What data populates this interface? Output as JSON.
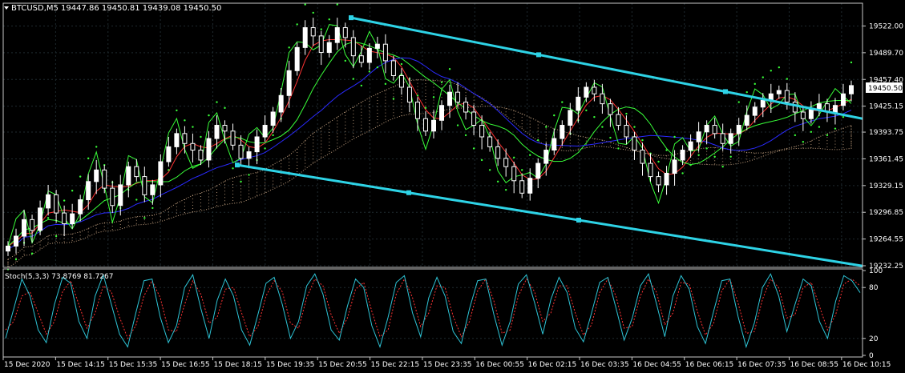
{
  "window": {
    "symbol_title": "BTCUSD,M5",
    "ohlc_text": "19447.86 19450.81 19439.08 19450.50",
    "current_price_label": "19450.50"
  },
  "colors": {
    "background": "#000000",
    "grid": "#1f2a2f",
    "axis": "#c8c8c8",
    "bull_candle": "#ffffff",
    "bear_candle": "#ffffff",
    "channel": "#2ed3e6",
    "cloud": "#f4c9a0",
    "ma_fast": "#ff3333",
    "ma_slow": "#2a2aff",
    "ma_green": "#39ff39",
    "psar": "#39ff39",
    "stoch_main": "#2ec4d6",
    "stoch_signal": "#ff3333"
  },
  "chart_data": [
    {
      "type": "candlestick",
      "title": "BTCUSD,M5",
      "price_ticks": [
        "19522.00",
        "19489.70",
        "19457.40",
        "19425.15",
        "19393.75",
        "19361.45",
        "19329.15",
        "19296.85",
        "19264.55",
        "19232.25"
      ],
      "ylim": [
        19232.25,
        19536.0
      ],
      "time_ticks": [
        "15 Dec 2020",
        "15 Dec 14:15",
        "15 Dec 15:35",
        "15 Dec 16:55",
        "15 Dec 18:15",
        "15 Dec 19:35",
        "15 Dec 20:55",
        "15 Dec 22:15",
        "15 Dec 23:35",
        "16 Dec 00:55",
        "16 Dec 02:15",
        "16 Dec 03:35",
        "16 Dec 04:55",
        "16 Dec 06:15",
        "16 Dec 07:35",
        "16 Dec 08:55",
        "16 Dec 10:15"
      ],
      "closes": [
        19256,
        19268,
        19288,
        19275,
        19302,
        19318,
        19296,
        19283,
        19295,
        19312,
        19334,
        19348,
        19326,
        19305,
        19330,
        19352,
        19340,
        19318,
        19330,
        19358,
        19376,
        19392,
        19380,
        19372,
        19360,
        19386,
        19402,
        19395,
        19378,
        19362,
        19370,
        19388,
        19402,
        19418,
        19438,
        19468,
        19496,
        19520,
        19510,
        19490,
        19502,
        19520,
        19508,
        19486,
        19478,
        19495,
        19500,
        19480,
        19462,
        19448,
        19430,
        19410,
        19395,
        19408,
        19426,
        19442,
        19430,
        19418,
        19402,
        19388,
        19376,
        19362,
        19352,
        19335,
        19320,
        19338,
        19356,
        19372,
        19386,
        19402,
        19420,
        19436,
        19448,
        19440,
        19428,
        19415,
        19402,
        19388,
        19372,
        19356,
        19340,
        19330,
        19344,
        19360,
        19372,
        19382,
        19394,
        19402,
        19392,
        19380,
        19392,
        19402,
        19414,
        19424,
        19432,
        19440,
        19444,
        19430,
        19418,
        19410,
        19422,
        19428,
        19418,
        19426,
        19440,
        19450
      ],
      "channel_upper": [
        19532,
        19410
      ],
      "channel_lower": [
        19354,
        19232
      ],
      "stochastic": {
        "label": "Stoch(5,3,3) 73.8769 81.7267",
        "levels": [
          "100",
          "80",
          "20",
          "0"
        ],
        "main": [
          20,
          55,
          90,
          70,
          30,
          15,
          60,
          92,
          85,
          40,
          20,
          70,
          95,
          60,
          25,
          10,
          50,
          88,
          90,
          45,
          15,
          35,
          80,
          95,
          55,
          20,
          65,
          90,
          70,
          30,
          12,
          48,
          85,
          92,
          60,
          20,
          40,
          82,
          96,
          72,
          30,
          18,
          58,
          90,
          80,
          35,
          10,
          45,
          86,
          94,
          50,
          22,
          68,
          92,
          70,
          28,
          14,
          55,
          88,
          90,
          48,
          12,
          40,
          84,
          95,
          62,
          25,
          66,
          92,
          74,
          32,
          16,
          50,
          86,
          92,
          56,
          18,
          44,
          82,
          96,
          60,
          22,
          70,
          94,
          78,
          34,
          14,
          52,
          88,
          90,
          46,
          10,
          38,
          80,
          96,
          70,
          28,
          60,
          90,
          82,
          40,
          20,
          64,
          94,
          88,
          74
        ],
        "signal": [
          30,
          40,
          70,
          75,
          50,
          25,
          40,
          75,
          88,
          60,
          32,
          50,
          82,
          75,
          45,
          20,
          35,
          70,
          88,
          68,
          30,
          28,
          60,
          88,
          72,
          38,
          45,
          78,
          80,
          50,
          22,
          34,
          70,
          88,
          75,
          38,
          32,
          68,
          90,
          82,
          48,
          26,
          44,
          78,
          86,
          52,
          22,
          30,
          72,
          90,
          68,
          34,
          50,
          82,
          80,
          46,
          22,
          40,
          76,
          90,
          64,
          26,
          30,
          70,
          90,
          75,
          40,
          50,
          82,
          82,
          50,
          24,
          36,
          74,
          90,
          70,
          32,
          34,
          70,
          90,
          74,
          36,
          50,
          86,
          84,
          52,
          24,
          38,
          76,
          90,
          62,
          26,
          28,
          66,
          90,
          80,
          44,
          48,
          80,
          86,
          58,
          30,
          48,
          84,
          90,
          82
        ]
      }
    }
  ]
}
